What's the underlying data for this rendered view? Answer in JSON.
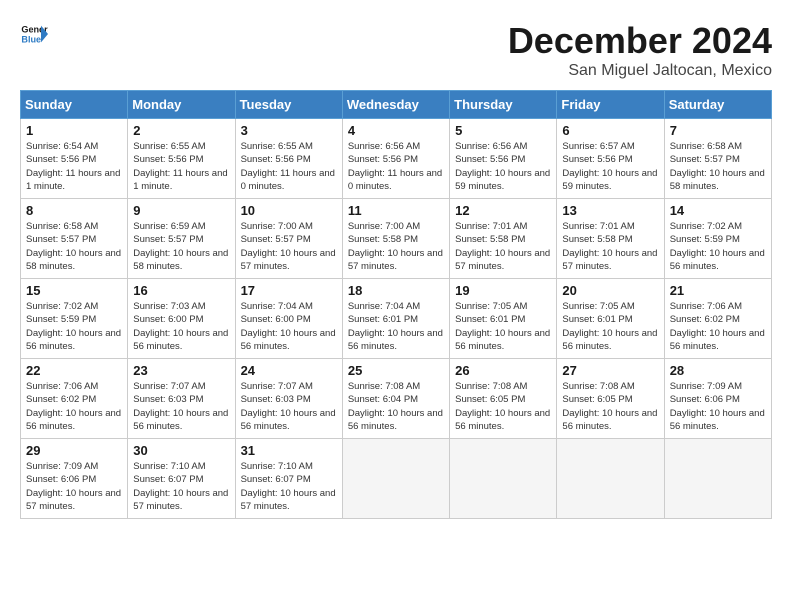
{
  "header": {
    "logo_line1": "General",
    "logo_line2": "Blue",
    "month": "December 2024",
    "location": "San Miguel Jaltocan, Mexico"
  },
  "days_of_week": [
    "Sunday",
    "Monday",
    "Tuesday",
    "Wednesday",
    "Thursday",
    "Friday",
    "Saturday"
  ],
  "weeks": [
    [
      {
        "day": "1",
        "info": "Sunrise: 6:54 AM\nSunset: 5:56 PM\nDaylight: 11 hours and 1 minute."
      },
      {
        "day": "2",
        "info": "Sunrise: 6:55 AM\nSunset: 5:56 PM\nDaylight: 11 hours and 1 minute."
      },
      {
        "day": "3",
        "info": "Sunrise: 6:55 AM\nSunset: 5:56 PM\nDaylight: 11 hours and 0 minutes."
      },
      {
        "day": "4",
        "info": "Sunrise: 6:56 AM\nSunset: 5:56 PM\nDaylight: 11 hours and 0 minutes."
      },
      {
        "day": "5",
        "info": "Sunrise: 6:56 AM\nSunset: 5:56 PM\nDaylight: 10 hours and 59 minutes."
      },
      {
        "day": "6",
        "info": "Sunrise: 6:57 AM\nSunset: 5:56 PM\nDaylight: 10 hours and 59 minutes."
      },
      {
        "day": "7",
        "info": "Sunrise: 6:58 AM\nSunset: 5:57 PM\nDaylight: 10 hours and 58 minutes."
      }
    ],
    [
      {
        "day": "8",
        "info": "Sunrise: 6:58 AM\nSunset: 5:57 PM\nDaylight: 10 hours and 58 minutes."
      },
      {
        "day": "9",
        "info": "Sunrise: 6:59 AM\nSunset: 5:57 PM\nDaylight: 10 hours and 58 minutes."
      },
      {
        "day": "10",
        "info": "Sunrise: 7:00 AM\nSunset: 5:57 PM\nDaylight: 10 hours and 57 minutes."
      },
      {
        "day": "11",
        "info": "Sunrise: 7:00 AM\nSunset: 5:58 PM\nDaylight: 10 hours and 57 minutes."
      },
      {
        "day": "12",
        "info": "Sunrise: 7:01 AM\nSunset: 5:58 PM\nDaylight: 10 hours and 57 minutes."
      },
      {
        "day": "13",
        "info": "Sunrise: 7:01 AM\nSunset: 5:58 PM\nDaylight: 10 hours and 57 minutes."
      },
      {
        "day": "14",
        "info": "Sunrise: 7:02 AM\nSunset: 5:59 PM\nDaylight: 10 hours and 56 minutes."
      }
    ],
    [
      {
        "day": "15",
        "info": "Sunrise: 7:02 AM\nSunset: 5:59 PM\nDaylight: 10 hours and 56 minutes."
      },
      {
        "day": "16",
        "info": "Sunrise: 7:03 AM\nSunset: 6:00 PM\nDaylight: 10 hours and 56 minutes."
      },
      {
        "day": "17",
        "info": "Sunrise: 7:04 AM\nSunset: 6:00 PM\nDaylight: 10 hours and 56 minutes."
      },
      {
        "day": "18",
        "info": "Sunrise: 7:04 AM\nSunset: 6:01 PM\nDaylight: 10 hours and 56 minutes."
      },
      {
        "day": "19",
        "info": "Sunrise: 7:05 AM\nSunset: 6:01 PM\nDaylight: 10 hours and 56 minutes."
      },
      {
        "day": "20",
        "info": "Sunrise: 7:05 AM\nSunset: 6:01 PM\nDaylight: 10 hours and 56 minutes."
      },
      {
        "day": "21",
        "info": "Sunrise: 7:06 AM\nSunset: 6:02 PM\nDaylight: 10 hours and 56 minutes."
      }
    ],
    [
      {
        "day": "22",
        "info": "Sunrise: 7:06 AM\nSunset: 6:02 PM\nDaylight: 10 hours and 56 minutes."
      },
      {
        "day": "23",
        "info": "Sunrise: 7:07 AM\nSunset: 6:03 PM\nDaylight: 10 hours and 56 minutes."
      },
      {
        "day": "24",
        "info": "Sunrise: 7:07 AM\nSunset: 6:03 PM\nDaylight: 10 hours and 56 minutes."
      },
      {
        "day": "25",
        "info": "Sunrise: 7:08 AM\nSunset: 6:04 PM\nDaylight: 10 hours and 56 minutes."
      },
      {
        "day": "26",
        "info": "Sunrise: 7:08 AM\nSunset: 6:05 PM\nDaylight: 10 hours and 56 minutes."
      },
      {
        "day": "27",
        "info": "Sunrise: 7:08 AM\nSunset: 6:05 PM\nDaylight: 10 hours and 56 minutes."
      },
      {
        "day": "28",
        "info": "Sunrise: 7:09 AM\nSunset: 6:06 PM\nDaylight: 10 hours and 56 minutes."
      }
    ],
    [
      {
        "day": "29",
        "info": "Sunrise: 7:09 AM\nSunset: 6:06 PM\nDaylight: 10 hours and 57 minutes."
      },
      {
        "day": "30",
        "info": "Sunrise: 7:10 AM\nSunset: 6:07 PM\nDaylight: 10 hours and 57 minutes."
      },
      {
        "day": "31",
        "info": "Sunrise: 7:10 AM\nSunset: 6:07 PM\nDaylight: 10 hours and 57 minutes."
      },
      null,
      null,
      null,
      null
    ]
  ]
}
